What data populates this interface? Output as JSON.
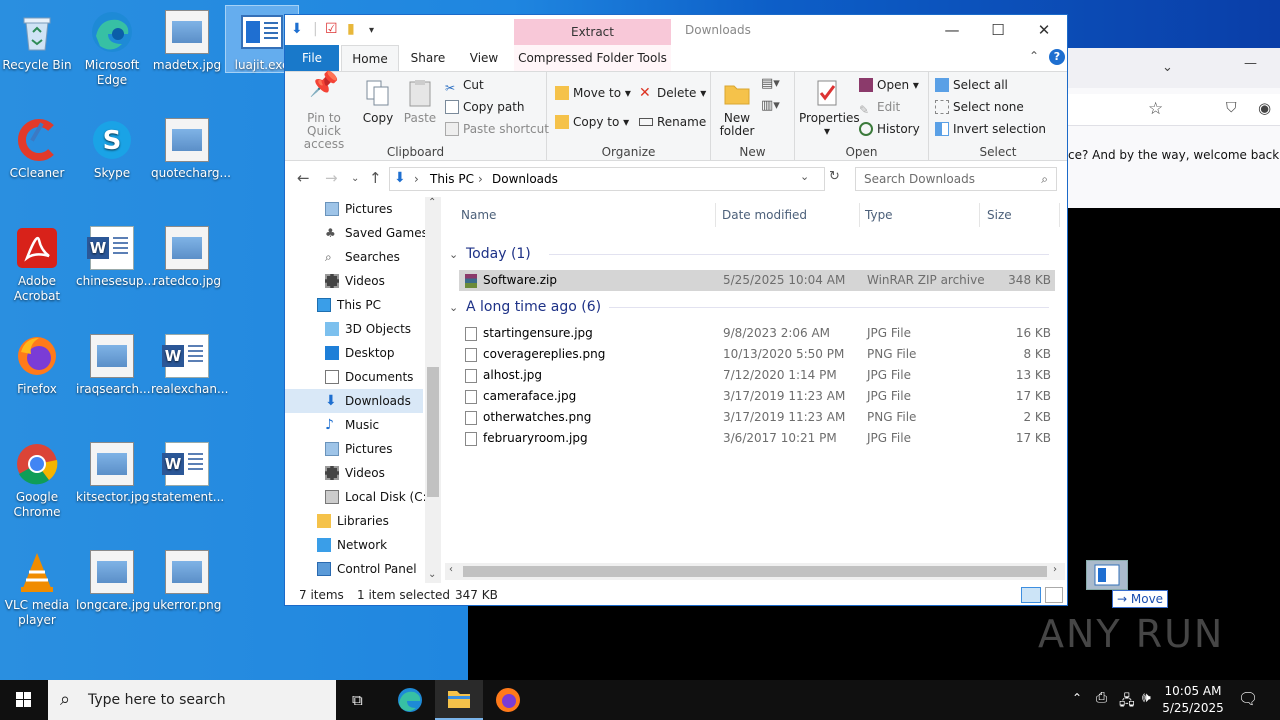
{
  "desktop": {
    "icons": [
      {
        "label": "Recycle Bin"
      },
      {
        "label": "Microsoft Edge"
      },
      {
        "label": "madetx.jpg"
      },
      {
        "label": "luajit.exe"
      },
      {
        "label": "CCleaner"
      },
      {
        "label": "Skype"
      },
      {
        "label": "quotecharg..."
      },
      {
        "label": "Adobe Acrobat"
      },
      {
        "label": "chinesesup..."
      },
      {
        "label": "ratedco.jpg"
      },
      {
        "label": "Firefox"
      },
      {
        "label": "iraqsearch..."
      },
      {
        "label": "realexchan..."
      },
      {
        "label": "Google Chrome"
      },
      {
        "label": "kitsector.jpg"
      },
      {
        "label": "statement..."
      },
      {
        "label": "VLC media player"
      },
      {
        "label": "longcare.jpg"
      },
      {
        "label": "ukerror.png"
      }
    ]
  },
  "browser": {
    "message": "ce? And by the way, welcome back!"
  },
  "window": {
    "contextual_tab": "Extract",
    "title": "Downloads",
    "ribbon_tabs": {
      "file": "File",
      "home": "Home",
      "share": "Share",
      "view": "View",
      "compressed": "Compressed Folder Tools"
    },
    "ribbon": {
      "clipboard": {
        "label": "Clipboard",
        "pin": "Pin to Quick access",
        "copy": "Copy",
        "paste": "Paste",
        "cut": "Cut",
        "copy_path": "Copy path",
        "paste_shortcut": "Paste shortcut"
      },
      "organize": {
        "label": "Organize",
        "move_to": "Move to",
        "copy_to": "Copy to",
        "delete": "Delete",
        "rename": "Rename"
      },
      "new": {
        "label": "New",
        "new_folder": "New folder"
      },
      "open": {
        "label": "Open",
        "properties": "Properties",
        "open": "Open",
        "edit": "Edit",
        "history": "History"
      },
      "select": {
        "label": "Select",
        "select_all": "Select all",
        "select_none": "Select none",
        "invert": "Invert selection"
      }
    },
    "address": {
      "crumbs": [
        "This PC",
        "Downloads"
      ],
      "search_placeholder": "Search Downloads"
    },
    "nav_items": [
      {
        "label": "Pictures"
      },
      {
        "label": "Saved Games"
      },
      {
        "label": "Searches"
      },
      {
        "label": "Videos"
      },
      {
        "label": "This PC"
      },
      {
        "label": "3D Objects"
      },
      {
        "label": "Desktop"
      },
      {
        "label": "Documents"
      },
      {
        "label": "Downloads"
      },
      {
        "label": "Music"
      },
      {
        "label": "Pictures"
      },
      {
        "label": "Videos"
      },
      {
        "label": "Local Disk (C:)"
      },
      {
        "label": "Libraries"
      },
      {
        "label": "Network"
      },
      {
        "label": "Control Panel"
      }
    ],
    "columns": {
      "name": "Name",
      "date": "Date modified",
      "type": "Type",
      "size": "Size"
    },
    "groups": [
      {
        "title": "Today (1)",
        "files": [
          {
            "name": "Software.zip",
            "date": "5/25/2025 10:04 AM",
            "type": "WinRAR ZIP archive",
            "size": "348 KB"
          }
        ]
      },
      {
        "title": "A long time ago (6)",
        "files": [
          {
            "name": "startingensure.jpg",
            "date": "9/8/2023 2:06 AM",
            "type": "JPG File",
            "size": "16 KB"
          },
          {
            "name": "coveragereplies.png",
            "date": "10/13/2020 5:50 PM",
            "type": "PNG File",
            "size": "8 KB"
          },
          {
            "name": "alhost.jpg",
            "date": "7/12/2020 1:14 PM",
            "type": "JPG File",
            "size": "13 KB"
          },
          {
            "name": "cameraface.jpg",
            "date": "3/17/2019 11:23 AM",
            "type": "JPG File",
            "size": "17 KB"
          },
          {
            "name": "otherwatches.png",
            "date": "3/17/2019 11:23 AM",
            "type": "PNG File",
            "size": "2 KB"
          },
          {
            "name": "februaryroom.jpg",
            "date": "3/6/2017 10:21 PM",
            "type": "JPG File",
            "size": "17 KB"
          }
        ]
      }
    ],
    "status": {
      "items": "7 items",
      "selected": "1 item selected",
      "size": "347 KB"
    }
  },
  "drag": {
    "tooltip": "→ Move"
  },
  "watermark": "ANY RUN",
  "taskbar": {
    "search_placeholder": "Type here to search",
    "time": "10:05 AM",
    "date": "5/25/2025"
  }
}
